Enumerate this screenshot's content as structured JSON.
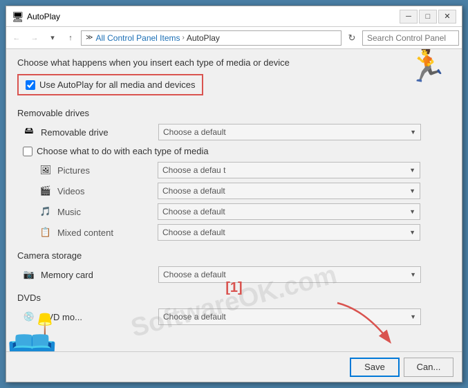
{
  "window": {
    "title": "AutoPlay",
    "icon": "autoplay-icon"
  },
  "titlebar": {
    "minimize_label": "─",
    "maximize_label": "□",
    "close_label": "✕"
  },
  "addressbar": {
    "back_label": "←",
    "forward_label": "→",
    "up_label": "↑",
    "breadcrumb1": "All Control Panel Items",
    "breadcrumb2": "AutoPlay",
    "refresh_label": "↻",
    "search_placeholder": "Search Control Panel"
  },
  "content": {
    "intro_text": "Choose what happens when you insert each type of media or device",
    "autoplay_label": "Use AutoPlay for all media and devices",
    "autoplay_checked": true,
    "sections": [
      {
        "id": "removable-drives",
        "heading": "Removable drives",
        "items": [
          {
            "id": "removable-drive",
            "icon": "💾",
            "label": "Removable drive",
            "dropdown": "Choose a default",
            "indent": 0
          }
        ],
        "sub_checkbox": "Choose what to do with each type of media",
        "sub_checked": false,
        "sub_items": [
          {
            "id": "pictures",
            "icon": "🖼",
            "label": "Pictures",
            "dropdown": "Choose a default"
          },
          {
            "id": "videos",
            "icon": "🎬",
            "label": "Videos",
            "dropdown": "Choose a default"
          },
          {
            "id": "music",
            "icon": "🎵",
            "label": "Music",
            "dropdown": "Choose a default"
          },
          {
            "id": "mixed-content",
            "icon": "📋",
            "label": "Mixed content",
            "dropdown": "Choose a default"
          }
        ]
      },
      {
        "id": "camera-storage",
        "heading": "Camera storage",
        "items": [
          {
            "id": "memory-card",
            "icon": "📷",
            "label": "Memory card",
            "dropdown": "Choose a default"
          }
        ]
      },
      {
        "id": "dvds",
        "heading": "DVDs",
        "items": [
          {
            "id": "dvd-movie",
            "icon": "💿",
            "label": "DVD mo...",
            "dropdown": "Choose a default"
          }
        ]
      }
    ]
  },
  "footer": {
    "save_label": "Save",
    "cancel_label": "Can..."
  },
  "annotation": {
    "label": "[1]"
  }
}
